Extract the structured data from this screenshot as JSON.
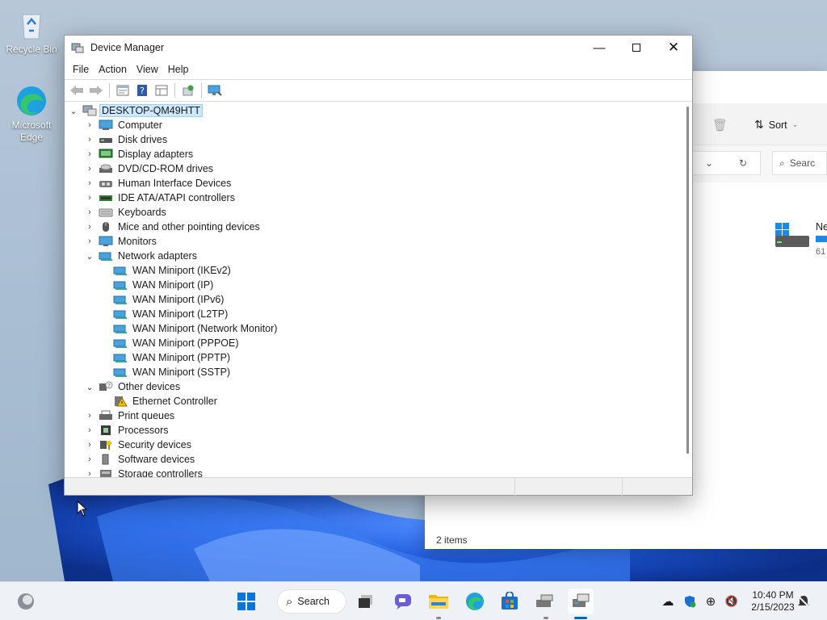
{
  "desktop": {
    "icons": [
      {
        "label": "Recycle Bin",
        "icon": "recycle-bin-icon"
      },
      {
        "label": "Microsoft Edge",
        "icon": "edge-icon"
      }
    ]
  },
  "explorer": {
    "sort_label": "Sort",
    "search_placeholder": "Searc",
    "item_title_partial": "Ne",
    "item_sub_partial": "61",
    "status": "2 items"
  },
  "device_manager": {
    "title": "Device Manager",
    "menu": [
      "File",
      "Action",
      "View",
      "Help"
    ],
    "toolbar": [
      "back-icon",
      "forward-icon",
      "properties-icon",
      "help-icon",
      "view-icon",
      "update-driver-icon",
      "scan-hardware-icon"
    ],
    "root": "DESKTOP-QM49HTT",
    "categories": [
      {
        "label": "Computer",
        "expanded": false
      },
      {
        "label": "Disk drives",
        "expanded": false
      },
      {
        "label": "Display adapters",
        "expanded": false
      },
      {
        "label": "DVD/CD-ROM drives",
        "expanded": false
      },
      {
        "label": "Human Interface Devices",
        "expanded": false
      },
      {
        "label": "IDE ATA/ATAPI controllers",
        "expanded": false
      },
      {
        "label": "Keyboards",
        "expanded": false
      },
      {
        "label": "Mice and other pointing devices",
        "expanded": false
      },
      {
        "label": "Monitors",
        "expanded": false
      },
      {
        "label": "Network adapters",
        "expanded": true,
        "children": [
          "WAN Miniport (IKEv2)",
          "WAN Miniport (IP)",
          "WAN Miniport (IPv6)",
          "WAN Miniport (L2TP)",
          "WAN Miniport (Network Monitor)",
          "WAN Miniport (PPPOE)",
          "WAN Miniport (PPTP)",
          "WAN Miniport (SSTP)"
        ]
      },
      {
        "label": "Other devices",
        "expanded": true,
        "children": [
          "Ethernet Controller"
        ]
      },
      {
        "label": "Print queues",
        "expanded": false
      },
      {
        "label": "Processors",
        "expanded": false
      },
      {
        "label": "Security devices",
        "expanded": false
      },
      {
        "label": "Software devices",
        "expanded": false
      },
      {
        "label": "Storage controllers",
        "expanded": false
      }
    ]
  },
  "taskbar": {
    "search_label": "Search",
    "time": "10:40 PM",
    "date": "2/15/2023"
  },
  "colors": {
    "accent": "#0067c0",
    "selection": "#cce8ff",
    "wallpaper_blue": "#1f5fd6"
  }
}
